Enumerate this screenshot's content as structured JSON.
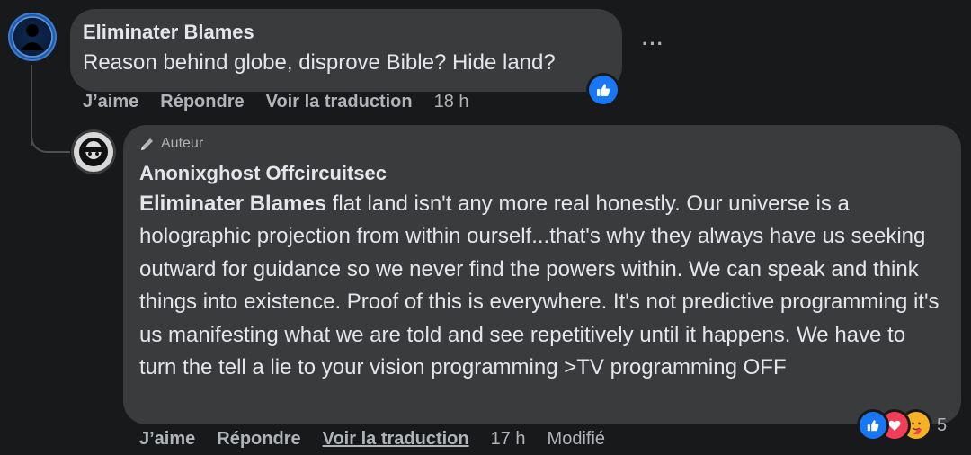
{
  "comment1": {
    "author": "Eliminater Blames",
    "text": "Reason behind globe, disprove Bible? Hide land?",
    "more_label": "···",
    "actions": {
      "like": "J’aime",
      "reply": "Répondre",
      "translate": "Voir la traduction",
      "time": "18 h"
    }
  },
  "comment2": {
    "badge": "Auteur",
    "author": "Anonixghost Offcircuitsec",
    "mention": "Eliminater Blames",
    "text": " flat land isn't any more real honestly. Our universe is a holographic projection from within ourself...that's why they always have us seeking outward for guidance so we never find the powers within. We can speak and think things into existence. Proof of this is everywhere. It's not predictive programming it's us manifesting what we are told and see repetitively until it happens. We have to turn the tell a lie to your vision programming >TV programming OFF",
    "actions": {
      "like": "J’aime",
      "reply": "Répondre",
      "translate": "Voir la traduction",
      "time": "17 h",
      "edited": "Modifié"
    },
    "reaction_count": "5"
  },
  "colors": {
    "background": "#18191a",
    "bubble": "#3a3b3c",
    "like_blue": "#1877f2",
    "love_red": "#f33e58",
    "care_yellow": "#f7b125"
  },
  "icons": [
    "avatar-anonymous",
    "avatar-ghost",
    "like-icon",
    "love-icon",
    "care-icon",
    "pencil-icon",
    "more-icon"
  ]
}
